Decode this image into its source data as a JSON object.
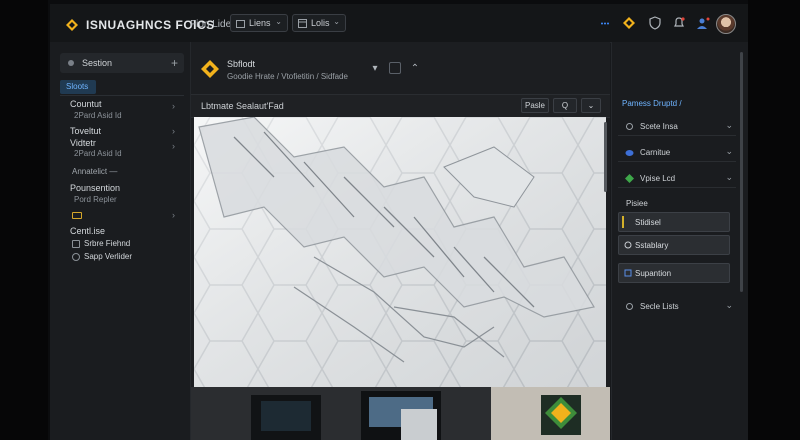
{
  "app": {
    "title": "ISNUAGHNCS FOICS",
    "file_label": "Fion Lide"
  },
  "topbar": {
    "dropdown1_label": "Liens",
    "dropdown2_label": "Lolis",
    "dropdown_chevron": "⌄"
  },
  "sidebar": {
    "search_label": "Sestion",
    "add_symbol": "+",
    "active_tab": "Sloots",
    "items": [
      {
        "label": "Countut",
        "sub": "2Pard Asid Id"
      },
      {
        "label": "Toveltut",
        "sub": ""
      },
      {
        "label": "Vidtetr",
        "sub": "2Pard Asid Id"
      }
    ],
    "section_label": "Annatelict —",
    "items2": [
      {
        "label": "Pounsention",
        "sub": "Pord Repler"
      }
    ],
    "items3": [
      {
        "label": "Centl.ise"
      },
      {
        "label": "Srbre Fiehnd"
      },
      {
        "label": "Sapp Verlider"
      }
    ],
    "chevron": "›"
  },
  "center": {
    "project_title": "Sbflodt",
    "project_sub": "Goodie Hrate / Vtofietitin / Sidfade",
    "canvas_title": "Lbtmate Sealaut'Fad",
    "btn_paste": "Pasle",
    "btn_q": "Q",
    "btn_chev": "⌄"
  },
  "rpanel": {
    "header": "Pamess Druptd /",
    "rows": [
      {
        "label": "Scete Insa",
        "chev": "⌄"
      },
      {
        "label": "Carnitue",
        "chev": "⌄"
      },
      {
        "label": "Vpise Lcd",
        "chev": "⌄"
      }
    ],
    "group_label": "Pisiee",
    "boxes": [
      {
        "label": "Stidisel"
      },
      {
        "label": "Sstablary"
      },
      {
        "label": "Supantion"
      }
    ],
    "last_row": {
      "label": "Secle Lists",
      "chev": "⌄"
    }
  },
  "colors": {
    "accent": "#3d8bff",
    "logo": "#f2b21c"
  }
}
